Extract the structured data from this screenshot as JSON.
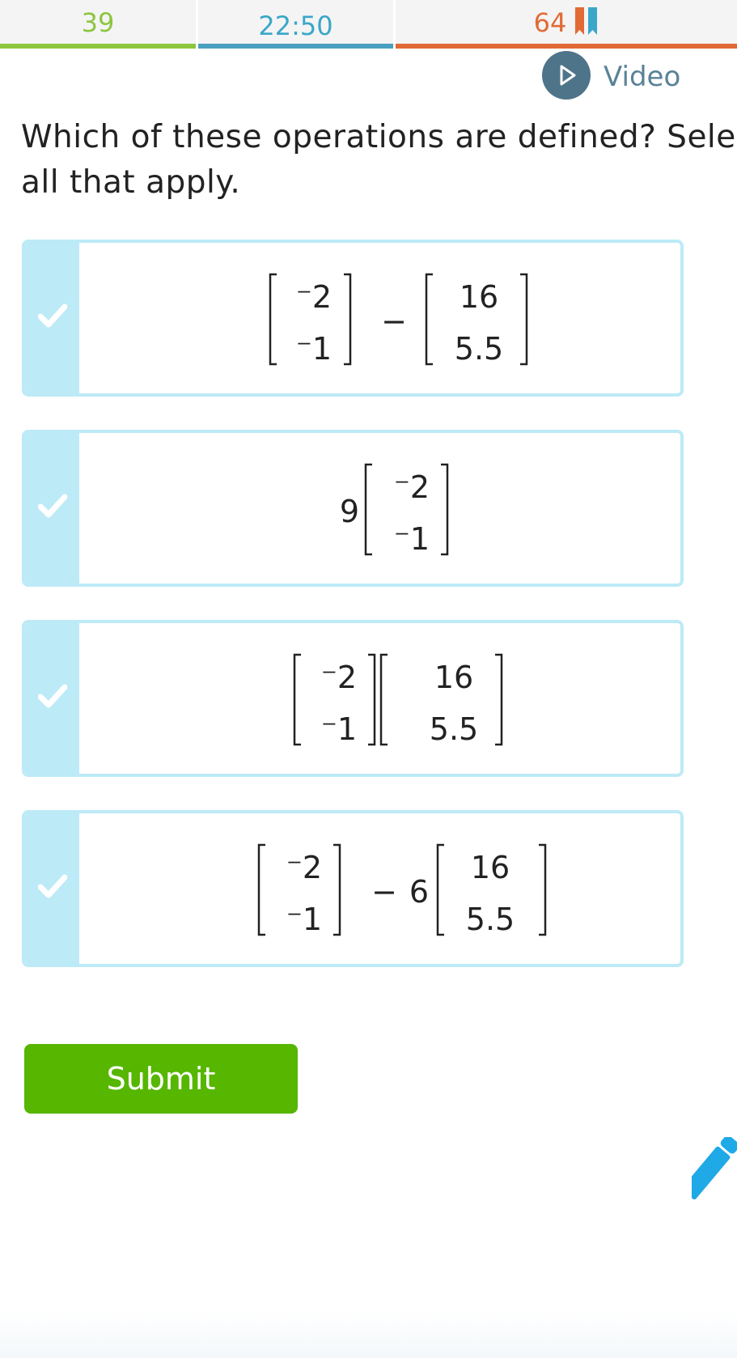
{
  "stats": {
    "questions_answered": "39",
    "time_elapsed": "22:50",
    "smart_score": "64",
    "colors": {
      "questions": "#8cc63f",
      "time": "#3aa7c9",
      "score": "#e16a35"
    },
    "score_icon": "bookmark-ribbon-icon"
  },
  "video": {
    "label": "Video",
    "icon": "play-icon"
  },
  "question": {
    "text": "Which of these operations are defined? Select all that apply."
  },
  "choices": [
    {
      "expression": "[⁻2, ⁻1] − [16, 5.5]",
      "left_matrix": [
        "⁻2",
        "⁻1"
      ],
      "operator": "−",
      "scalar": "",
      "right_matrix": [
        "16",
        "5.5"
      ]
    },
    {
      "expression": "9[⁻2, ⁻1]",
      "scalar": "9",
      "matrix": [
        "⁻2",
        "⁻1"
      ]
    },
    {
      "expression": "[⁻2, ⁻1][16, 5.5]",
      "left_matrix": [
        "⁻2",
        "⁻1"
      ],
      "right_matrix": [
        "16",
        "5.5"
      ]
    },
    {
      "expression": "[⁻2, ⁻1] − 6[16, 5.5]",
      "left_matrix": [
        "⁻2",
        "⁻1"
      ],
      "operator": "−",
      "scalar": "6",
      "right_matrix": [
        "16",
        "5.5"
      ]
    }
  ],
  "choice_icon": "check-icon",
  "submit": {
    "label": "Submit"
  },
  "tools": {
    "pencil_icon": "pencil-icon"
  }
}
